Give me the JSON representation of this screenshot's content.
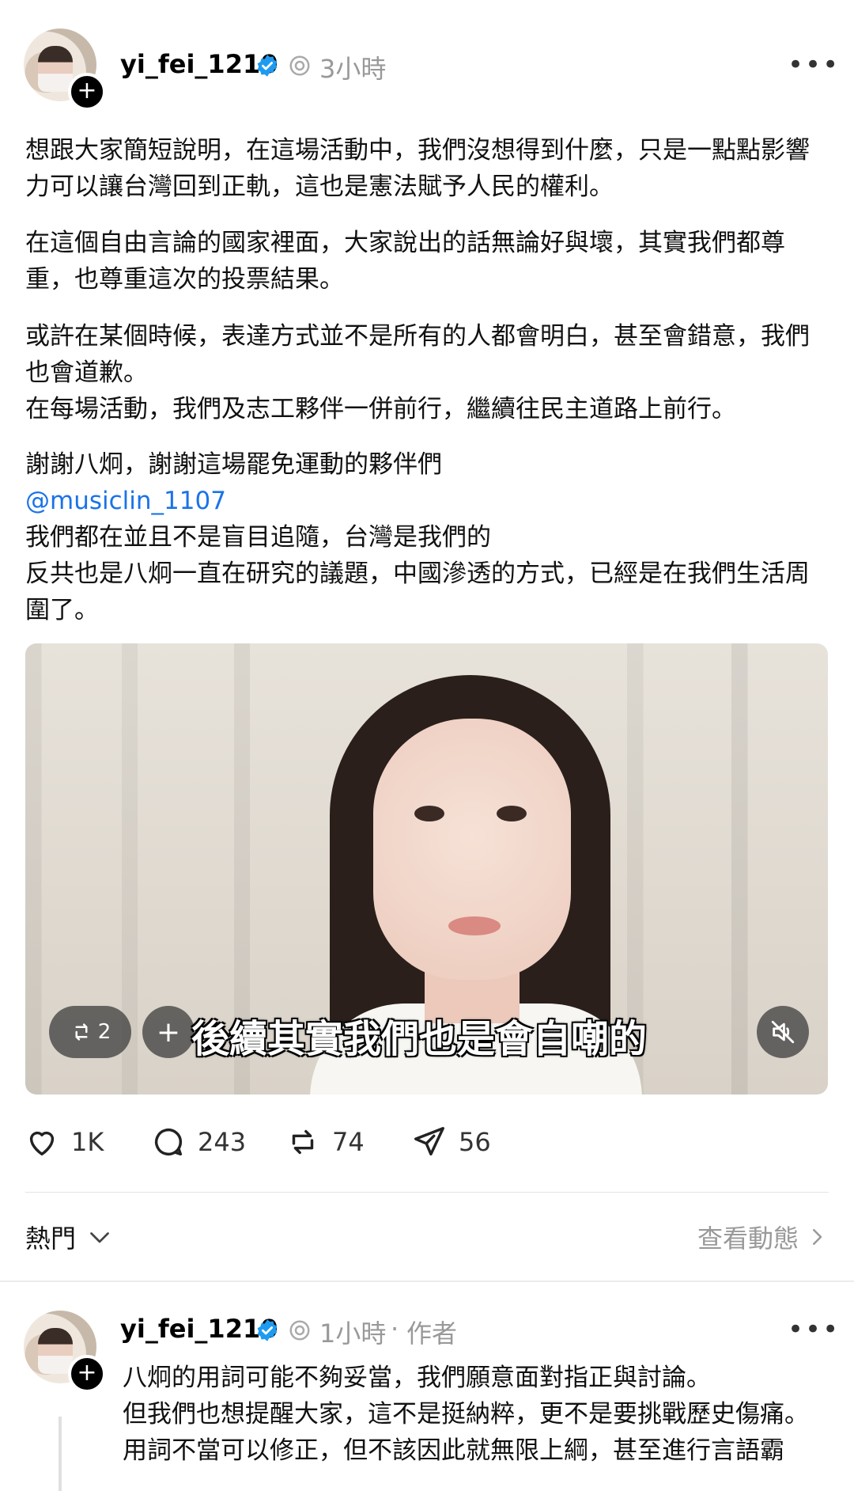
{
  "post": {
    "username": "yi_fei_1210",
    "time": "3小時",
    "more": "•••",
    "paragraphs": [
      "想跟大家簡短說明，在這場活動中，我們沒想得到什麼，只是一點點影響力可以讓台灣回到正軌，這也是憲法賦予人民的權利。",
      "在這個自由言論的國家裡面，大家說出的話無論好與壞，其實我們都尊重，也尊重這次的投票結果。",
      "或許在某個時候，表達方式並不是所有的人都會明白，甚至會錯意，我們也會道歉。",
      "在每場活動，我們及志工夥伴一併前行，繼續往民主道路上前行。",
      "謝謝八炯，謝謝這場罷免運動的夥伴們",
      "@musiclin_1107",
      "我們都在並且不是盲目追隨，台灣是我們的",
      "反共也是八炯一直在研究的議題，中國滲透的方式，已經是在我們生活周圍了。"
    ],
    "video": {
      "repost_count": "2",
      "caption": "後續其實我們也是會自嘲的",
      "plus": "+"
    },
    "actions": {
      "likes": "1K",
      "comments": "243",
      "reposts": "74",
      "shares": "56"
    }
  },
  "sort": {
    "label": "熱門",
    "activity": "查看動態"
  },
  "reply": {
    "username": "yi_fei_1210",
    "time": "1小時",
    "separator": "·",
    "author_tag": "作者",
    "more": "•••",
    "lines": [
      "八炯的用詞可能不夠妥當，我們願意面對指正與討論。",
      "但我們也想提醒大家，這不是挺納粹，更不是要挑戰歷史傷痛。",
      "用詞不當可以修正，但不該因此就無限上綱，甚至進行言語霸"
    ]
  },
  "colors": {
    "verified": "#1d9bf0",
    "mention": "#1a73e8",
    "muted": "#999999"
  },
  "icons": [
    "plus-icon",
    "verified-icon",
    "threads-ai-icon",
    "more-icon",
    "heart-icon",
    "comment-icon",
    "repost-icon",
    "share-icon",
    "chevron-down-icon",
    "chevron-right-icon",
    "mute-icon"
  ]
}
